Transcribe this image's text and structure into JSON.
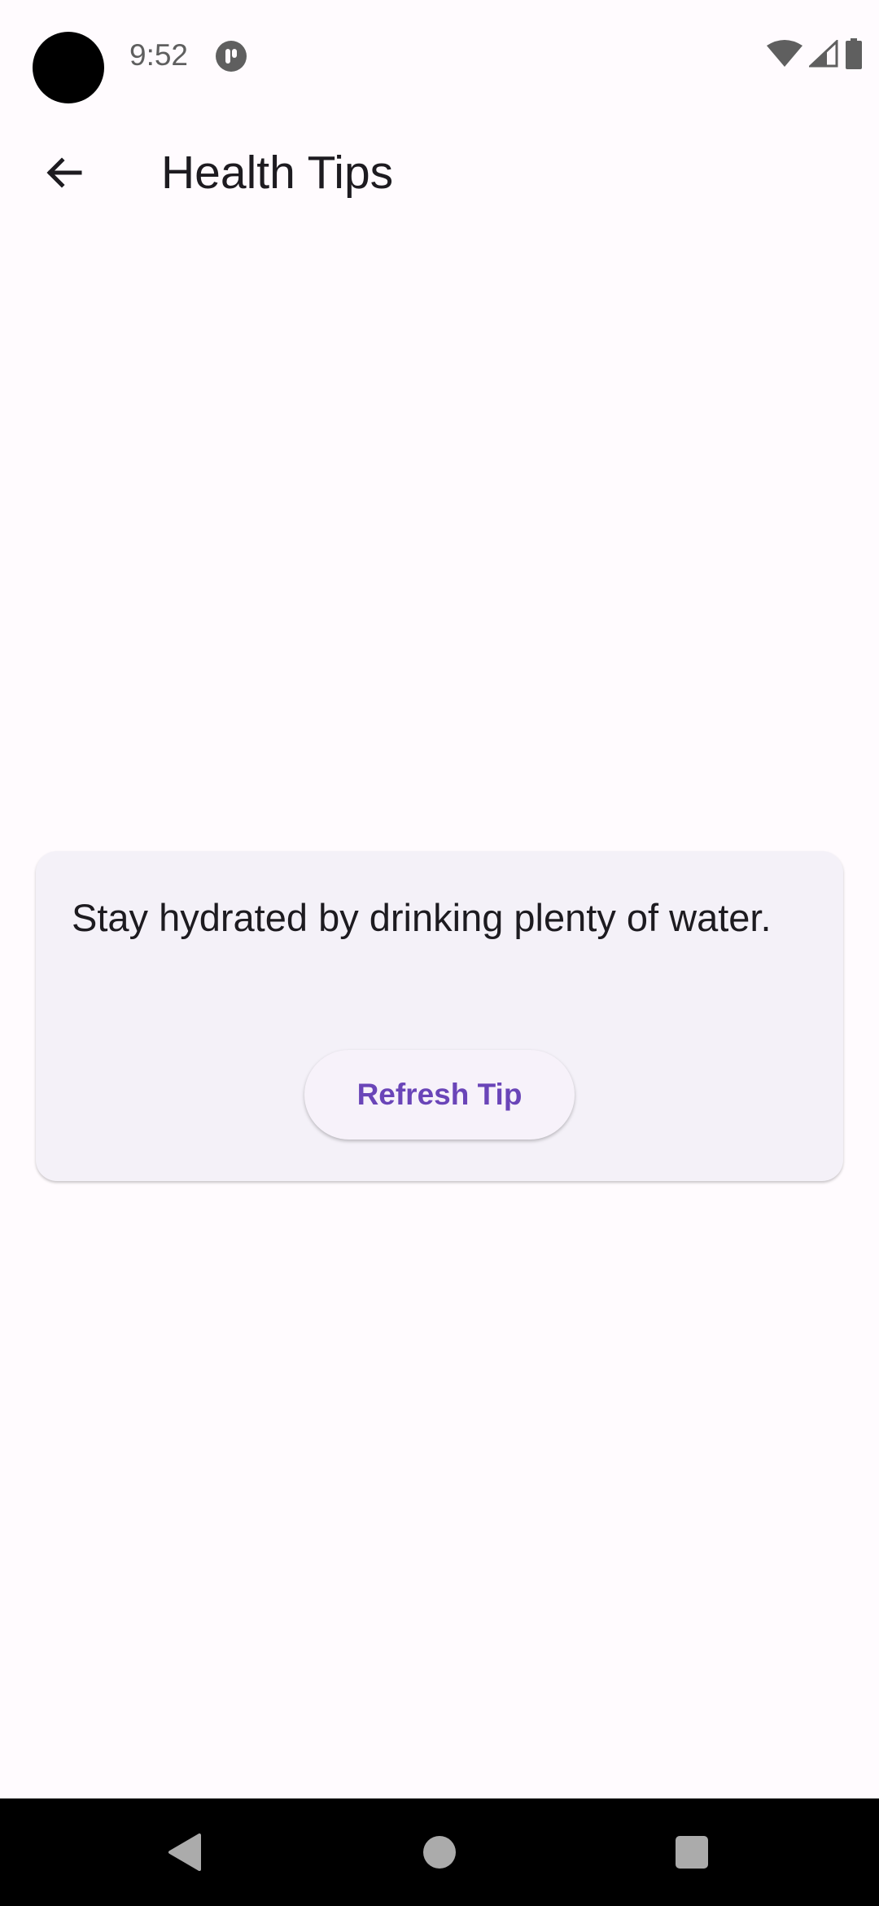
{
  "status_bar": {
    "time": "9:52",
    "icons": [
      "app-notification-icon",
      "wifi-icon",
      "cell-signal-icon",
      "battery-icon"
    ]
  },
  "app_bar": {
    "title": "Health Tips",
    "back_icon": "arrow-back-icon"
  },
  "tip_card": {
    "tip_text": "Stay hydrated by drinking plenty of water.",
    "refresh_label": "Refresh Tip"
  },
  "nav_bar": {
    "buttons": [
      "back-icon",
      "home-icon",
      "recents-icon"
    ]
  },
  "colors": {
    "background": "#fffbfe",
    "card": "#f4f1f8",
    "accent": "#6a45b8",
    "text": "#1d1b20"
  }
}
